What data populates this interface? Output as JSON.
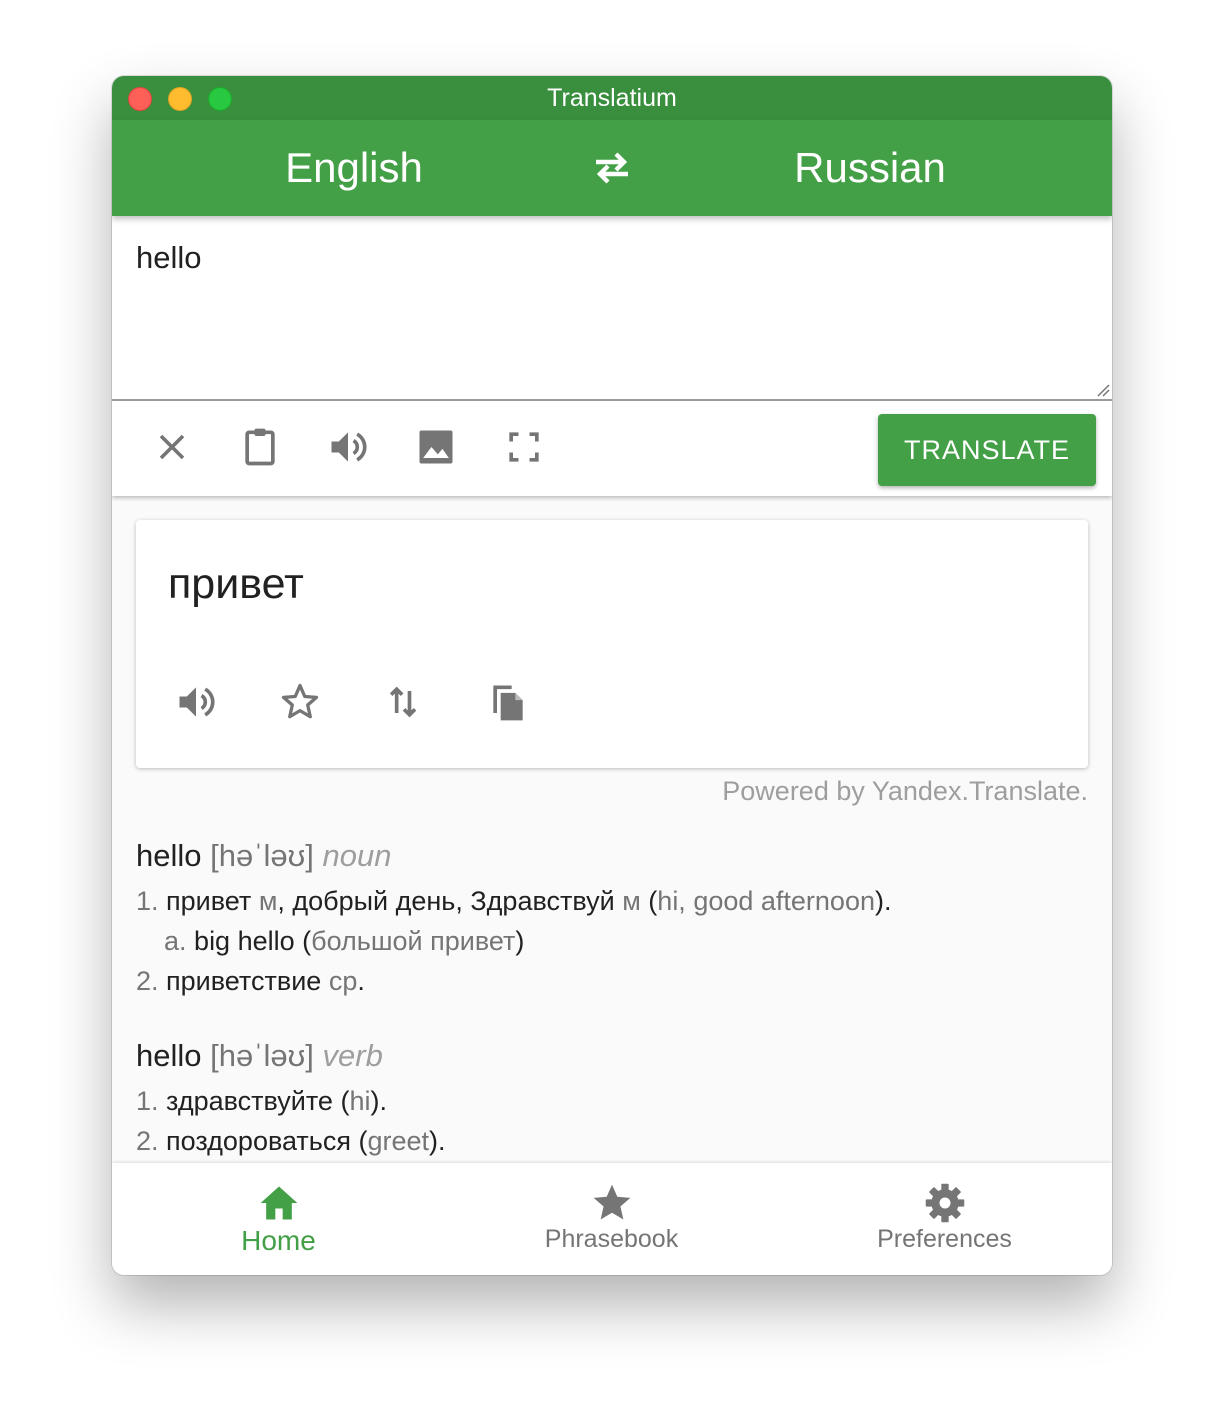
{
  "window": {
    "title": "Translatium"
  },
  "languages": {
    "source": "English",
    "target": "Russian"
  },
  "input": {
    "text": "hello"
  },
  "toolbar": {
    "translate_label": "TRANSLATE"
  },
  "result": {
    "text": "привет"
  },
  "attribution": "Powered by Yandex.Translate.",
  "dictionary": [
    {
      "word": "hello",
      "ipa": "[həˈləʊ]",
      "pos": "noun",
      "definitions": [
        {
          "num": "1.",
          "main": "привет",
          "gender": "м",
          "extra": ", добрый день, Здравствуй",
          "gender2": "м",
          "open": " (",
          "gloss": "hi, good afternoon",
          "close": ")."
        },
        {
          "num": "a.",
          "main": "big hello",
          "open": " (",
          "gloss": "большой привет",
          "close": ")"
        },
        {
          "num": "2.",
          "main": "приветствие",
          "gender": "ср",
          "close": "."
        }
      ]
    },
    {
      "word": "hello",
      "ipa": "[həˈləʊ]",
      "pos": "verb",
      "definitions": [
        {
          "num": "1.",
          "main": "здравствуйте",
          "open": " (",
          "gloss": "hi",
          "close": ")."
        },
        {
          "num": "2.",
          "main": "поздороваться",
          "open": " (",
          "gloss": "greet",
          "close": ")."
        }
      ]
    }
  ],
  "nav": {
    "home": "Home",
    "phrasebook": "Phrasebook",
    "preferences": "Preferences"
  },
  "colors": {
    "primary": "#43a047",
    "titlebar": "#3a8f3f",
    "icon": "#757575"
  }
}
